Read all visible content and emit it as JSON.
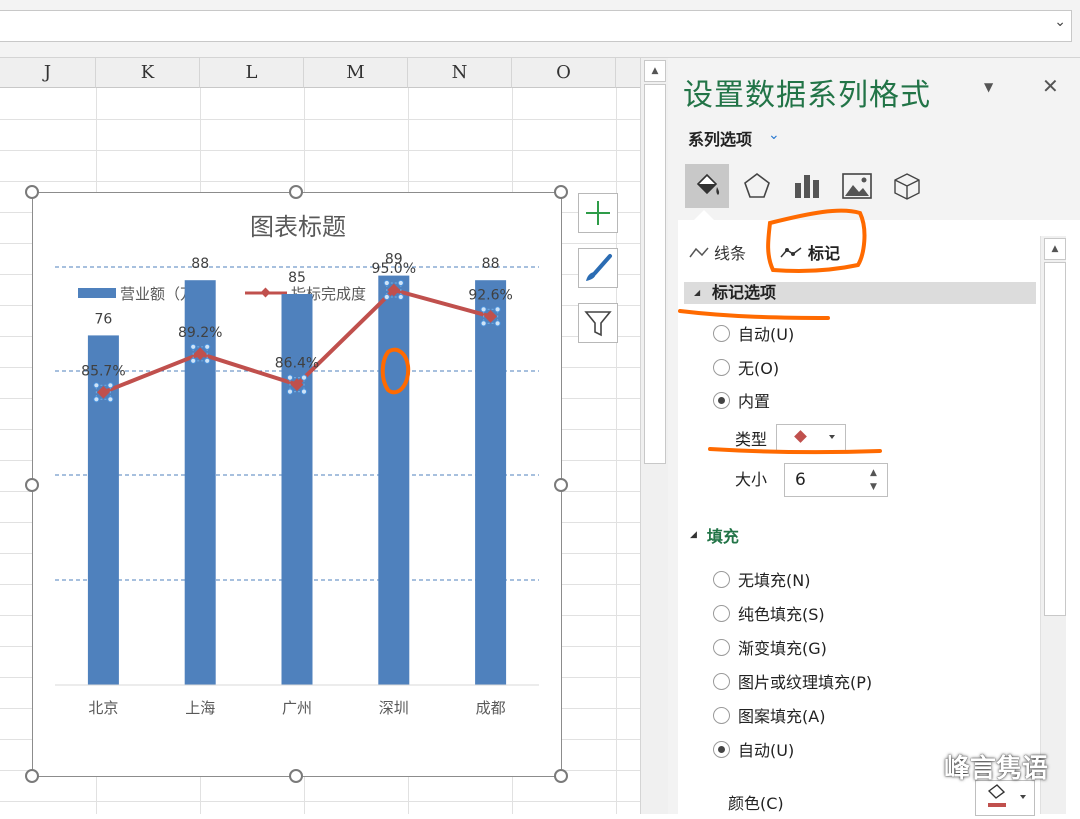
{
  "columns": [
    "J",
    "K",
    "L",
    "M",
    "N",
    "O"
  ],
  "chart": {
    "title": "图表标题",
    "legend": [
      {
        "name": "营业额（万）",
        "color": "#4f81bd",
        "kind": "bar"
      },
      {
        "name": "指标完成度",
        "color": "#c0504d",
        "kind": "line"
      }
    ]
  },
  "chart_data": {
    "type": "bar",
    "title": "图表标题",
    "categories": [
      "北京",
      "上海",
      "广州",
      "深圳",
      "成都"
    ],
    "series": [
      {
        "name": "营业额（万）",
        "type": "bar",
        "values": [
          76,
          88,
          85,
          89,
          88
        ],
        "labels": [
          "76",
          "88",
          "85",
          "89",
          "88"
        ],
        "color": "#4f81bd"
      },
      {
        "name": "指标完成度",
        "type": "line",
        "values": [
          0.857,
          0.892,
          0.864,
          0.95,
          0.926
        ],
        "labels": [
          "85.7%",
          "89.2%",
          "86.4%",
          "95.0%",
          "92.6%"
        ],
        "color": "#c0504d"
      }
    ],
    "legend_position": "top",
    "grid": true
  },
  "pane": {
    "title": "设置数据系列格式",
    "series_options": "系列选项",
    "subtabs": {
      "line": "线条",
      "marker": "标记"
    },
    "marker_section": "标记选项",
    "marker_radios": [
      "自动(U)",
      "无(O)",
      "内置"
    ],
    "marker_selected": 2,
    "type_label": "类型",
    "size_label": "大小",
    "size_value": "6",
    "fill_section": "填充",
    "fill_radios": [
      "无填充(N)",
      "纯色填充(S)",
      "渐变填充(G)",
      "图片或纹理填充(P)",
      "图案填充(A)",
      "自动(U)"
    ],
    "fill_selected": 5,
    "color_label": "颜色(C)"
  },
  "watermark": "峰言隽语",
  "annotation_color": "#ff6a00"
}
